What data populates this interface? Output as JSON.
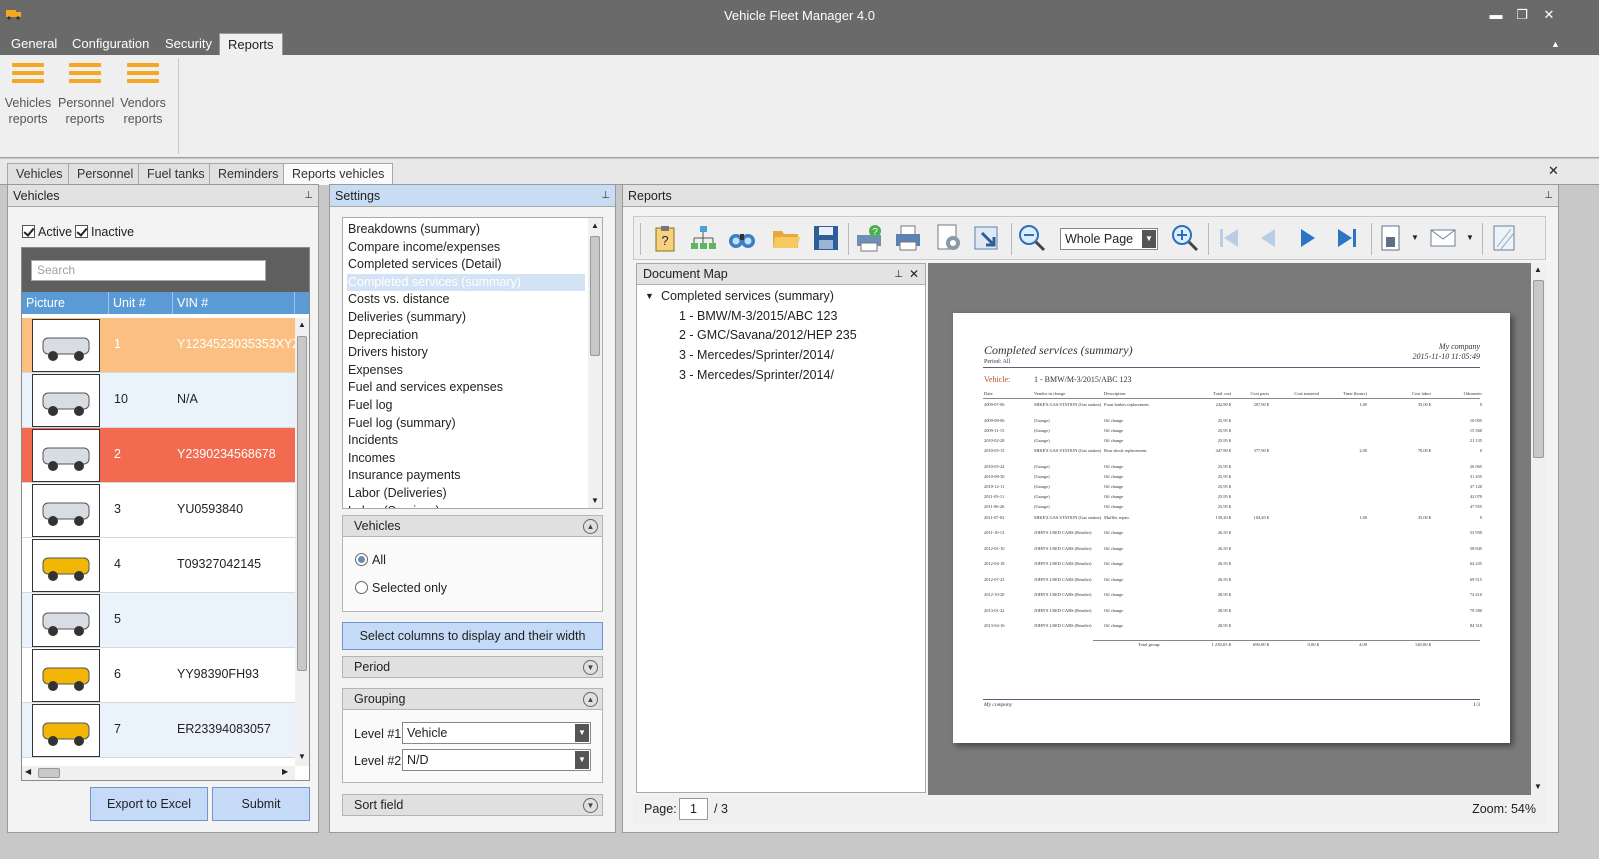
{
  "window": {
    "title": "Vehicle Fleet Manager 4.0",
    "minimize": "▬",
    "maximize": "❐",
    "close": "✕"
  },
  "ribbon_tabs": [
    "General",
    "Configuration",
    "Security",
    "Reports"
  ],
  "ribbon_buttons": [
    {
      "line1": "Vehicles",
      "line2": "reports"
    },
    {
      "line1": "Personnel",
      "line2": "reports"
    },
    {
      "line1": "Vendors",
      "line2": "reports"
    }
  ],
  "doc_tabs": [
    "Vehicles",
    "Personnel",
    "Fuel tanks",
    "Reminders",
    "Reports vehicles"
  ],
  "vehicles_panel": {
    "title": "Vehicles",
    "active_label": "Active",
    "inactive_label": "Inactive",
    "search_placeholder": "Search",
    "columns": [
      "Picture",
      "Unit #",
      "VIN #"
    ],
    "rows": [
      {
        "unit": "1",
        "vin": "Y1234523035353XYZ",
        "color": "#fbbf82"
      },
      {
        "unit": "10",
        "vin": "N/A",
        "color": "#eaf3fc"
      },
      {
        "unit": "2",
        "vin": "Y2390234568678",
        "color": "#f26a4f"
      },
      {
        "unit": "3",
        "vin": "YU0593840",
        "color": "#ffffff"
      },
      {
        "unit": "4",
        "vin": "T09327042145",
        "color": "#ffffff"
      },
      {
        "unit": "5",
        "vin": "",
        "color": "#eaf3fc"
      },
      {
        "unit": "6",
        "vin": "YY98390FH93",
        "color": "#ffffff"
      },
      {
        "unit": "7",
        "vin": "ER23394083057",
        "color": "#eaf3fc"
      }
    ],
    "export_label": "Export to Excel",
    "submit_label": "Submit"
  },
  "settings_panel": {
    "title": "Settings",
    "reports": [
      "Breakdowns (summary)",
      "Compare income/expenses",
      "Completed services (Detail)",
      "Completed services (summary)",
      "Costs vs. distance",
      "Deliveries (summary)",
      "Depreciation",
      "Drivers history",
      "Expenses",
      "Fuel and services expenses",
      "Fuel log",
      "Fuel log (summary)",
      "Incidents",
      "Incomes",
      "Insurance payments",
      "Labor (Deliveries)",
      "Labor (Services)"
    ],
    "selected_report": "Completed services (summary)",
    "vehicles_section": "Vehicles",
    "all_label": "All",
    "selected_only_label": "Selected only",
    "columns_button": "Select columns to display and their width",
    "period_section": "Period",
    "grouping_section": "Grouping",
    "level1_label": "Level #1:",
    "level1_value": "Vehicle",
    "level2_label": "Level #2:",
    "level2_value": "N/D",
    "sort_section": "Sort field"
  },
  "reports_panel": {
    "title": "Reports",
    "zoom_mode": "Whole Page",
    "document_map": {
      "title": "Document Map",
      "root": "Completed services (summary)",
      "items": [
        "1 - BMW/M-3/2015/ABC 123",
        "2 - GMC/Savana/2012/HEP 235",
        "3 - Mercedes/Sprinter/2014/",
        "3 - Mercedes/Sprinter/2014/"
      ]
    },
    "page_label": "Page:",
    "page_value": "1",
    "page_total": "/ 3",
    "zoom_label": "Zoom: 54%"
  },
  "report_page": {
    "title": "Completed services (summary)",
    "company": "My company",
    "datetime": "2015-11-10 11:05:49",
    "subtitle": "Period: All",
    "vehicle_label": "Vehicle:",
    "vehicle_value": "1 - BMW/M-3/2015/ABC 123",
    "columns": [
      "Date",
      "Vendor in charge",
      "Description",
      "Total cost",
      "Cost parts",
      "Cost material",
      "Time (hours)",
      "Cost labor",
      "Odometer"
    ],
    "rows": [
      [
        "2009-07-06",
        "MIKE'S GAS STATION (Gas station)",
        "Front brakes replacement.",
        "242,90 $",
        "207,90 $",
        "",
        "1,00",
        "35,00 $",
        "0"
      ],
      [
        "2009-08-06",
        "(Garage)",
        "Oil change",
        "25,95 $",
        "",
        "",
        "",
        "",
        "10 005"
      ],
      [
        "2009-11-15",
        "(Garage)",
        "Oil change",
        "25,95 $",
        "",
        "",
        "",
        "",
        "15 560"
      ],
      [
        "2010-02-28",
        "(Garage)",
        "Oil change",
        "25,95 $",
        "",
        "",
        "",
        "",
        "21 135"
      ],
      [
        "2010-05-15",
        "MIKE'S GAS STATION (Gas station)",
        "Rear shock replacement.",
        "447,90 $",
        "377,90 $",
        "",
        "2,00",
        "70,00 $",
        "0"
      ],
      [
        "2010-05-24",
        "(Garage)",
        "Oil change",
        "25,95 $",
        "",
        "",
        "",
        "",
        "26 065"
      ],
      [
        "2010-08-30",
        "(Garage)",
        "Oil change",
        "25,95 $",
        "",
        "",
        "",
        "",
        "31 455"
      ],
      [
        "2010-12-11",
        "(Garage)",
        "Oil change",
        "25,95 $",
        "",
        "",
        "",
        "",
        "37 120"
      ],
      [
        "2011-03-11",
        "(Garage)",
        "Oil change",
        "25,95 $",
        "",
        "",
        "",
        "",
        "42 070"
      ],
      [
        "2011-06-26",
        "(Garage)",
        "Oil change",
        "25,95 $",
        "",
        "",
        "",
        "",
        "47 955"
      ],
      [
        "2011-07-02",
        "MIKE'S GAS STATION (Gas station)",
        "Muffler repair.",
        "139,20 $",
        "104,20 $",
        "",
        "1,00",
        "35,00 $",
        "0"
      ],
      [
        "2011-10-13",
        "JOHN'S USED CARS (Retailer)",
        "Oil change",
        "26,55 $",
        "",
        "",
        "",
        "",
        "53 950"
      ],
      [
        "2012-01-10",
        "JOHN'S USED CARS (Retailer)",
        "Oil change",
        "26,55 $",
        "",
        "",
        "",
        "",
        "58 845"
      ],
      [
        "2012-04-18",
        "JOHN'S USED CARS (Retailer)",
        "Oil change",
        "26,55 $",
        "",
        "",
        "",
        "",
        "64 235"
      ],
      [
        "2012-07-23",
        "JOHN'S USED CARS (Retailer)",
        "Oil change",
        "26,55 $",
        "",
        "",
        "",
        "",
        "69 515"
      ],
      [
        "2012-10-20",
        "JOHN'S USED CARS (Retailer)",
        "Oil change",
        "28,95 $",
        "",
        "",
        "",
        "",
        "74 410"
      ],
      [
        "2013-01-22",
        "JOHN'S USED CARS (Retailer)",
        "Oil change",
        "28,95 $",
        "",
        "",
        "",
        "",
        "79 580"
      ],
      [
        "2013-04-16",
        "JOHN'S USED CARS (Retailer)",
        "Oil change",
        "28,95 $",
        "",
        "",
        "",
        "",
        "84 310"
      ]
    ],
    "total_label": "Total group:",
    "totals": [
      "1 230,65 $",
      "690,00 $",
      "0,00 $",
      "4,00",
      "140,00 $"
    ],
    "footer_company": "My company",
    "footer_page": "1/3"
  }
}
